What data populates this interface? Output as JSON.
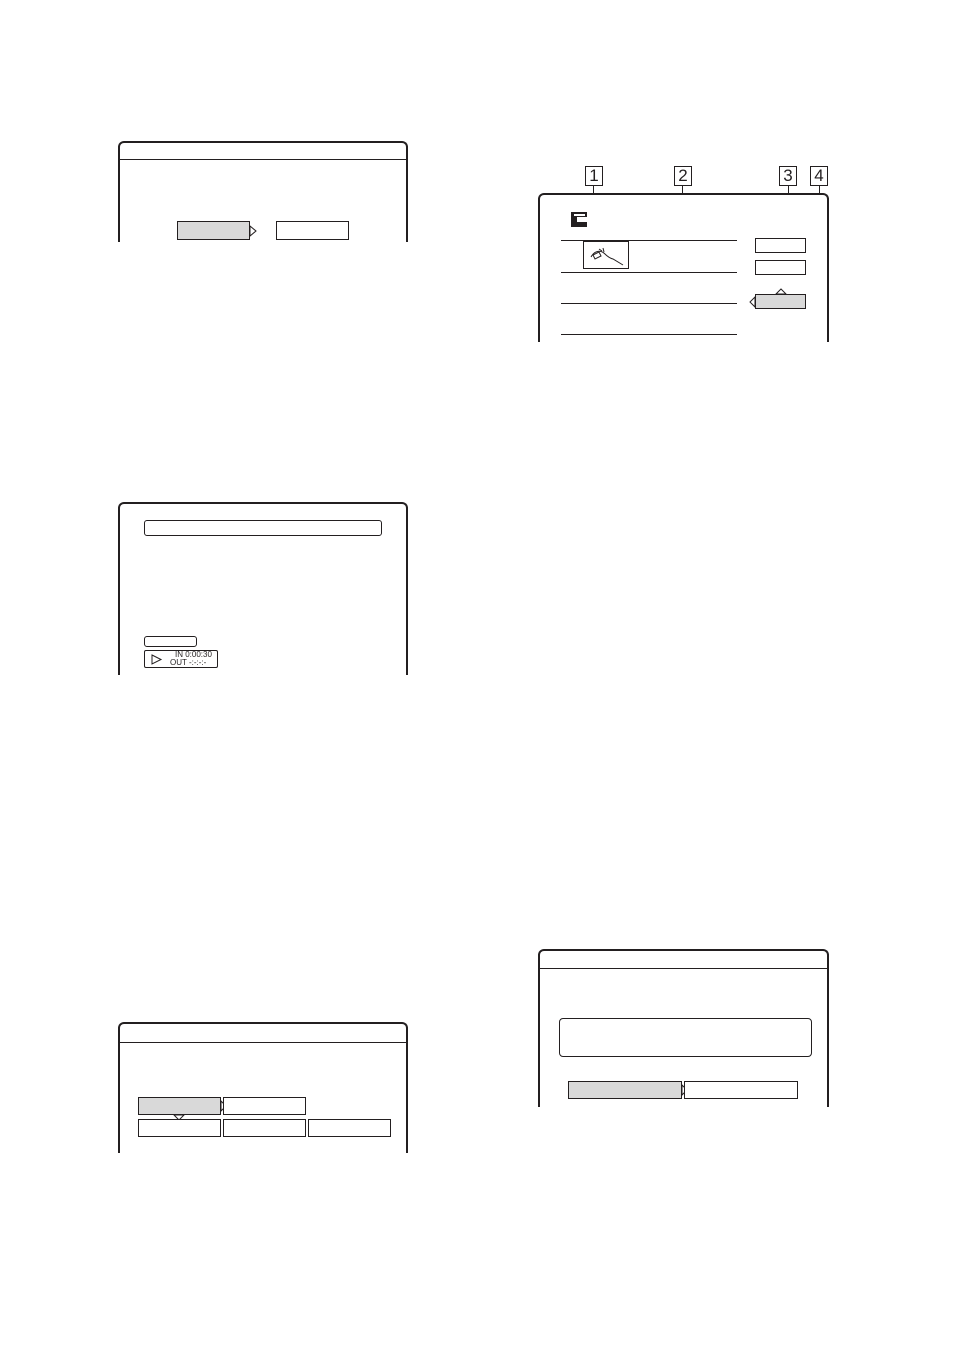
{
  "callouts": [
    "1",
    "2",
    "3",
    "4"
  ],
  "trim_marker": {
    "in_label": "IN 0:00:30",
    "out_label": "OUT -:-:-:-"
  },
  "icons": {
    "arrow": "right-arrow-icon",
    "disc_tray": "disc-tray-icon",
    "thumbnail": "title-thumbnail-icon",
    "play": "play-icon"
  },
  "colors": {
    "line": "#231f20",
    "selected_fill": "#d9d9d9",
    "background": "#ffffff"
  }
}
